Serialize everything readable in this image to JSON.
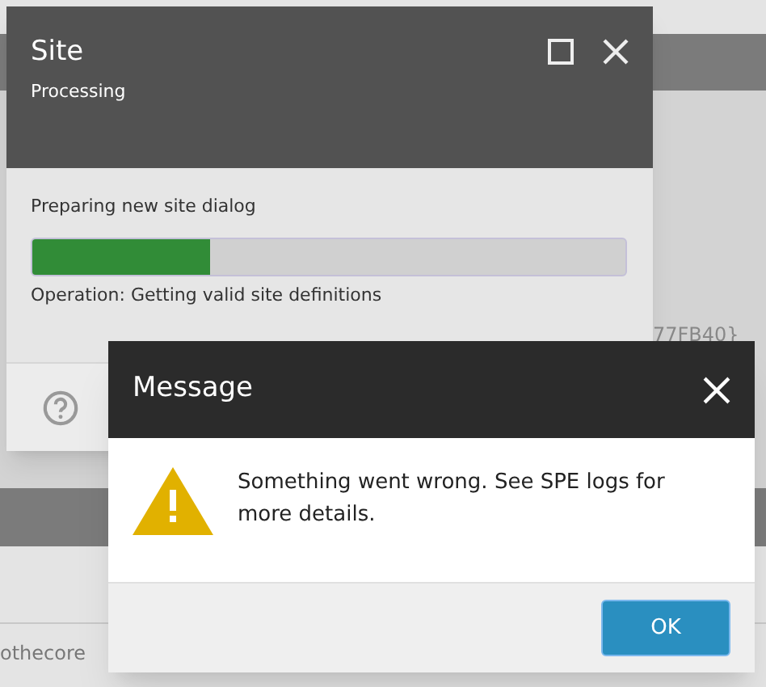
{
  "background": {
    "id_fragment": "77FB40}",
    "row_text": "othecore"
  },
  "site_dialog": {
    "title": "Site",
    "subtitle": "Processing",
    "status": "Preparing new site dialog",
    "progress": {
      "level": 0.3
    },
    "operation": "Operation: Getting valid site definitions"
  },
  "message_dialog": {
    "title": "Message",
    "text": "Something went wrong. See SPE logs for more details.",
    "buttons": [
      "OK"
    ]
  }
}
